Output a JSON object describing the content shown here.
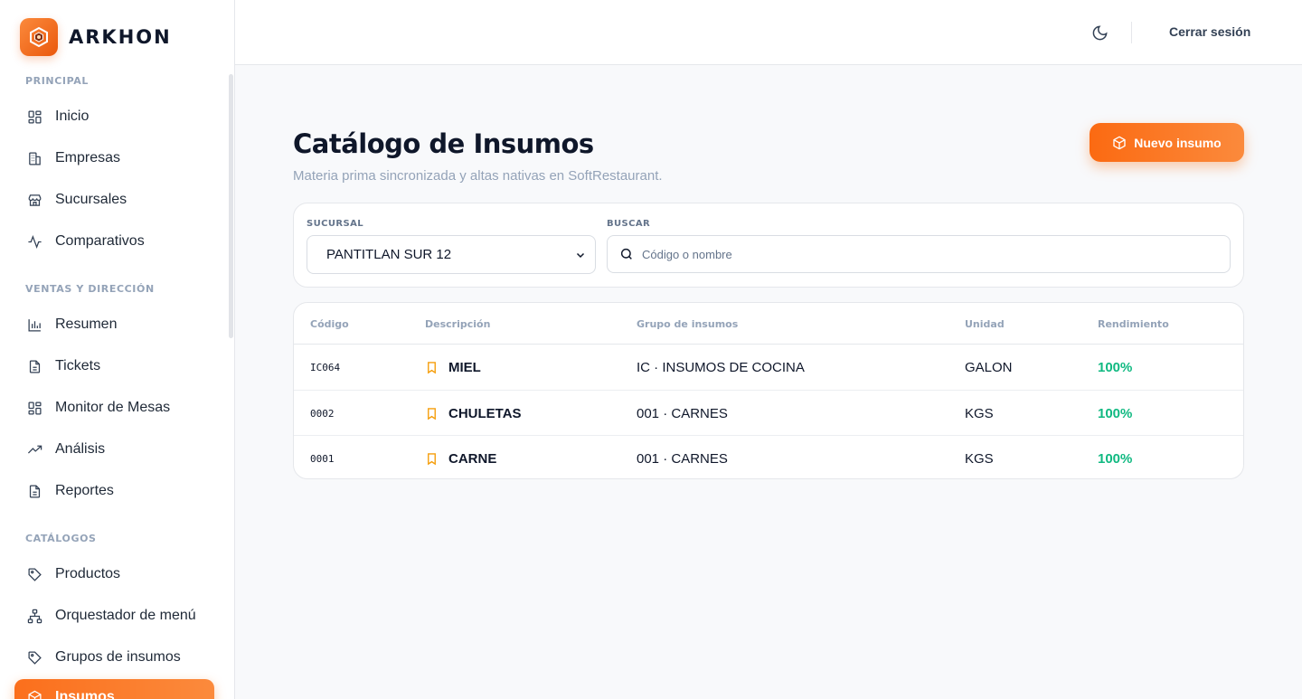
{
  "app": {
    "name": "ARKHON"
  },
  "sidebar": {
    "sections": [
      {
        "title": "PRINCIPAL"
      },
      {
        "title": "VENTAS Y DIRECCIÓN"
      },
      {
        "title": "CATÁLOGOS"
      }
    ],
    "items": [
      {
        "label": "Inicio",
        "icon": "grid-icon"
      },
      {
        "label": "Empresas",
        "icon": "building-icon"
      },
      {
        "label": "Sucursales",
        "icon": "store-icon"
      },
      {
        "label": "Comparativos",
        "icon": "activity-icon"
      },
      {
        "label": "Resumen",
        "icon": "bar-chart-icon"
      },
      {
        "label": "Tickets",
        "icon": "document-icon"
      },
      {
        "label": "Monitor de Mesas",
        "icon": "grid-icon"
      },
      {
        "label": "Análisis",
        "icon": "trending-up-icon"
      },
      {
        "label": "Reportes",
        "icon": "document-icon"
      },
      {
        "label": "Productos",
        "icon": "tag-icon"
      },
      {
        "label": "Orquestador de menú",
        "icon": "sitemap-icon"
      },
      {
        "label": "Grupos de insumos",
        "icon": "tag-icon"
      },
      {
        "label": "Insumos",
        "icon": "package-icon",
        "active": true
      }
    ]
  },
  "header": {
    "logout_label": "Cerrar sesión",
    "theme_icon": "moon-icon"
  },
  "page": {
    "title": "Catálogo de Insumos",
    "subtitle": "Materia prima sincronizada y altas nativas en SoftRestaurant.",
    "new_button_label": "Nuevo insumo"
  },
  "filters": {
    "branch_label": "SUCURSAL",
    "branch_value": "PANTITLAN SUR 12",
    "search_label": "BUSCAR",
    "search_placeholder": "Código o nombre"
  },
  "table": {
    "columns": [
      "Código",
      "Descripción",
      "Grupo de insumos",
      "Unidad",
      "Rendimiento"
    ],
    "rows": [
      {
        "code": "IC064",
        "description": "MIEL",
        "group": "IC · INSUMOS DE COCINA",
        "unit": "GALON",
        "yield": "100%"
      },
      {
        "code": "0002",
        "description": "CHULETAS",
        "group": "001 · CARNES",
        "unit": "KGS",
        "yield": "100%"
      },
      {
        "code": "0001",
        "description": "CARNE",
        "group": "001 · CARNES",
        "unit": "KGS",
        "yield": "100%"
      }
    ]
  },
  "colors": {
    "accent": "#f97316",
    "success": "#10b981",
    "bookmark": "#f59e0b"
  }
}
